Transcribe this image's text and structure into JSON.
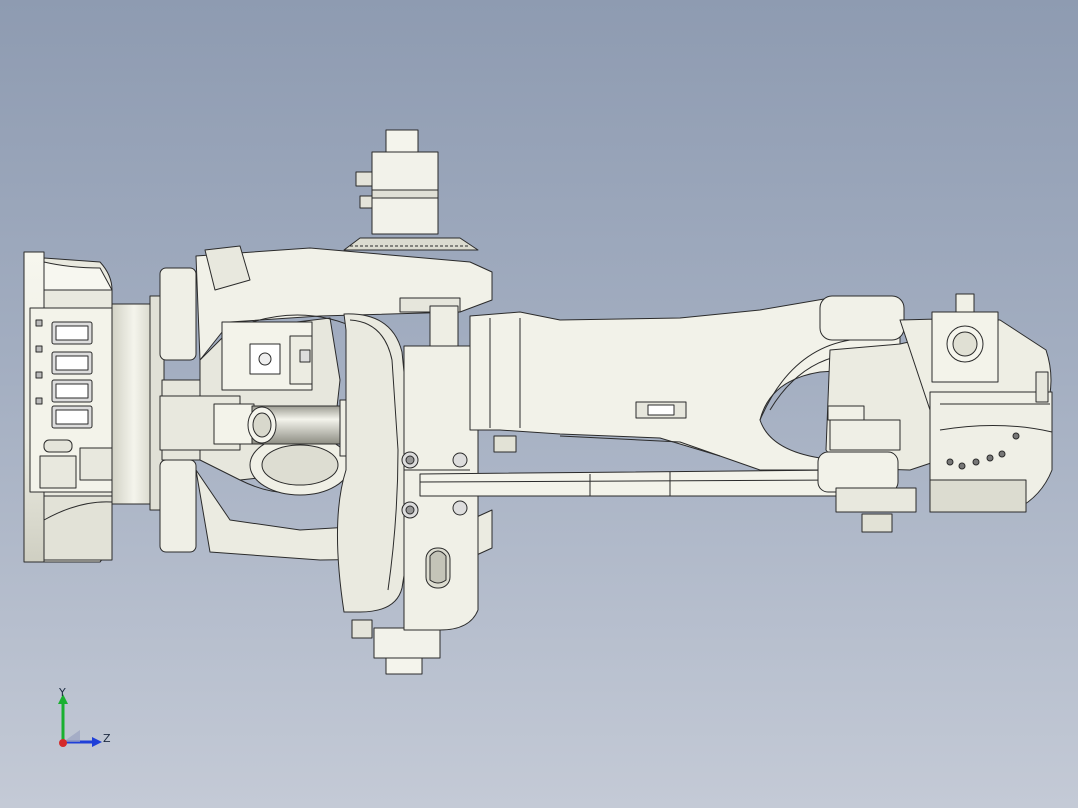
{
  "viewport": {
    "background_top": "#8e9bb1",
    "background_bottom": "#c4cad6",
    "part_fill": "#f1f1e8",
    "part_shade": "#d6d6ca",
    "edge_color": "#2b2b2b"
  },
  "triad": {
    "y_label": "Y",
    "z_label": "Z",
    "y_color": "#19b030",
    "z_color": "#1f3fd8",
    "x_color": "#d42a2a"
  }
}
